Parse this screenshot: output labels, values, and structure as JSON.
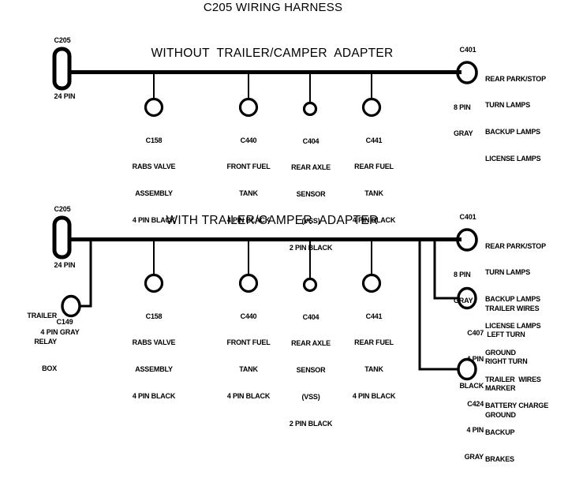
{
  "title": "C205 WIRING HARNESS",
  "colors": {
    "line": "#000000",
    "text": "#000000",
    "background": "#ffffff"
  },
  "sections": [
    {
      "heading": "WITHOUT  TRAILER/CAMPER  ADAPTER",
      "source": {
        "id": "C205",
        "pins": "24 PIN",
        "shape": "rounded-rect"
      },
      "drops": [
        {
          "id": "C158",
          "desc_lines": [
            "RABS VALVE",
            "ASSEMBLY",
            "4 PIN BLACK"
          ]
        },
        {
          "id": "C440",
          "desc_lines": [
            "FRONT FUEL",
            "TANK",
            "4 PIN BLACK"
          ]
        },
        {
          "id": "C404",
          "desc_lines": [
            "REAR AXLE",
            "SENSOR",
            "(VSS)",
            "2 PIN BLACK"
          ]
        },
        {
          "id": "C441",
          "desc_lines": [
            "REAR FUEL",
            "TANK",
            "4 PIN BLACK"
          ]
        }
      ],
      "endpoints": [
        {
          "id": "C401",
          "pins_lines": [
            "8 PIN",
            "GRAY"
          ],
          "desc_lines": [
            "REAR PARK/STOP",
            "TURN LAMPS",
            "BACKUP LAMPS",
            "LICENSE LAMPS"
          ]
        }
      ]
    },
    {
      "heading": "WITH TRAILER/CAMPER  ADAPTER",
      "source": {
        "id": "C205",
        "pins": "24 PIN",
        "shape": "rounded-rect"
      },
      "left_branch": {
        "name_lines": [
          "TRAILER",
          "RELAY",
          "BOX"
        ],
        "id": "C149",
        "pins": "4 PIN GRAY"
      },
      "drops": [
        {
          "id": "C158",
          "desc_lines": [
            "RABS VALVE",
            "ASSEMBLY",
            "4 PIN BLACK"
          ]
        },
        {
          "id": "C440",
          "desc_lines": [
            "FRONT FUEL",
            "TANK",
            "4 PIN BLACK"
          ]
        },
        {
          "id": "C404",
          "desc_lines": [
            "REAR AXLE",
            "SENSOR",
            "(VSS)",
            "2 PIN BLACK"
          ]
        },
        {
          "id": "C441",
          "desc_lines": [
            "REAR FUEL",
            "TANK",
            "4 PIN BLACK"
          ]
        }
      ],
      "endpoints": [
        {
          "id": "C401",
          "pins_lines": [
            "8 PIN",
            "GRAY"
          ],
          "desc_lines": [
            "REAR PARK/STOP",
            "TURN LAMPS",
            "BACKUP LAMPS",
            "LICENSE LAMPS",
            "GROUND"
          ]
        },
        {
          "id": "C407",
          "pins_lines": [
            "4 PIN",
            "BLACK"
          ],
          "desc_lines": [
            "TRAILER WIRES",
            " LEFT TURN",
            "RIGHT TURN",
            "MARKER",
            "GROUND"
          ]
        },
        {
          "id": "C424",
          "pins_lines": [
            "4 PIN",
            "GRAY"
          ],
          "desc_lines": [
            "TRAILER  WIRES",
            "BATTERY CHARGE",
            "BACKUP",
            "BRAKES"
          ]
        }
      ]
    }
  ]
}
